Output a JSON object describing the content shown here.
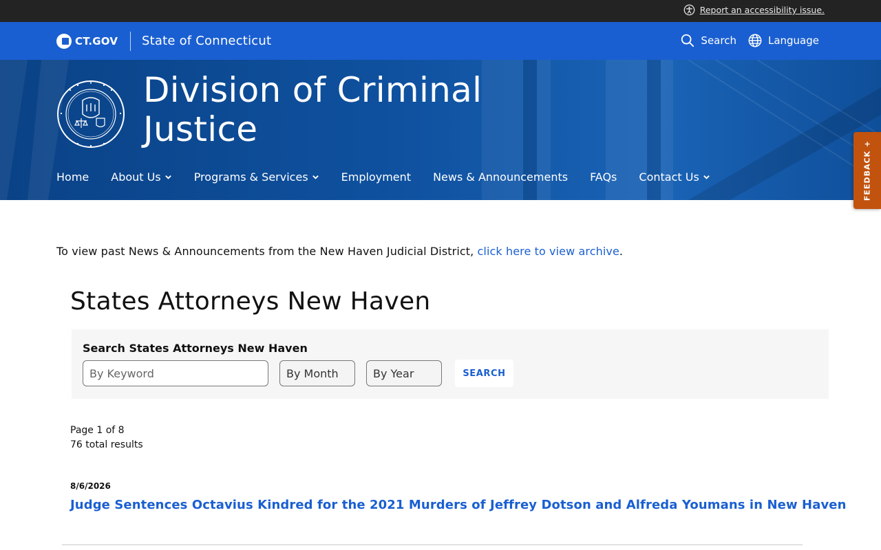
{
  "utility_bar": {
    "accessibility_link": "Report an accessibility issue."
  },
  "ct_bar": {
    "logo_text": "CT.GOV",
    "state_name": "State of Connecticut",
    "search_label": "Search",
    "language_label": "Language"
  },
  "hero": {
    "title_line1": "Division of Criminal",
    "title_line2": "Justice",
    "nav": [
      {
        "label": "Home",
        "dropdown": false
      },
      {
        "label": "About Us",
        "dropdown": true
      },
      {
        "label": "Programs & Services",
        "dropdown": true
      },
      {
        "label": "Employment",
        "dropdown": false
      },
      {
        "label": "News & Announcements",
        "dropdown": false
      },
      {
        "label": "FAQs",
        "dropdown": false
      },
      {
        "label": "Contact Us",
        "dropdown": true
      }
    ]
  },
  "feedback_tab": {
    "label": "FEEDBACK +"
  },
  "intro": {
    "text": "To view past News & Announcements from the New Haven Judicial District, ",
    "link_text": "click here to view archive",
    "trailing": "."
  },
  "page_heading": "States Attorneys New Haven",
  "search": {
    "label": "Search States Attorneys New Haven",
    "keyword_placeholder": "By Keyword",
    "month_value": "By Month",
    "year_value": "By Year",
    "button_label": "SEARCH"
  },
  "results": {
    "page_text": "Page 1 of 8",
    "total_text": "76 total results",
    "items": [
      {
        "date": "8/6/2026",
        "title": "Judge Sentences Octavius Kindred for the 2021 Murders of Jeffrey Dotson and Alfreda Youmans in New Haven"
      }
    ]
  },
  "colors": {
    "brand_blue": "#1a5fd1",
    "hero_blue": "#0d4a94",
    "utility_dark": "#232323",
    "feedback_orange": "#c1530f"
  },
  "icons": {
    "accessibility": "accessibility-icon",
    "search": "search-icon",
    "language": "globe-icon",
    "dropdown": "chevron-down-icon"
  }
}
